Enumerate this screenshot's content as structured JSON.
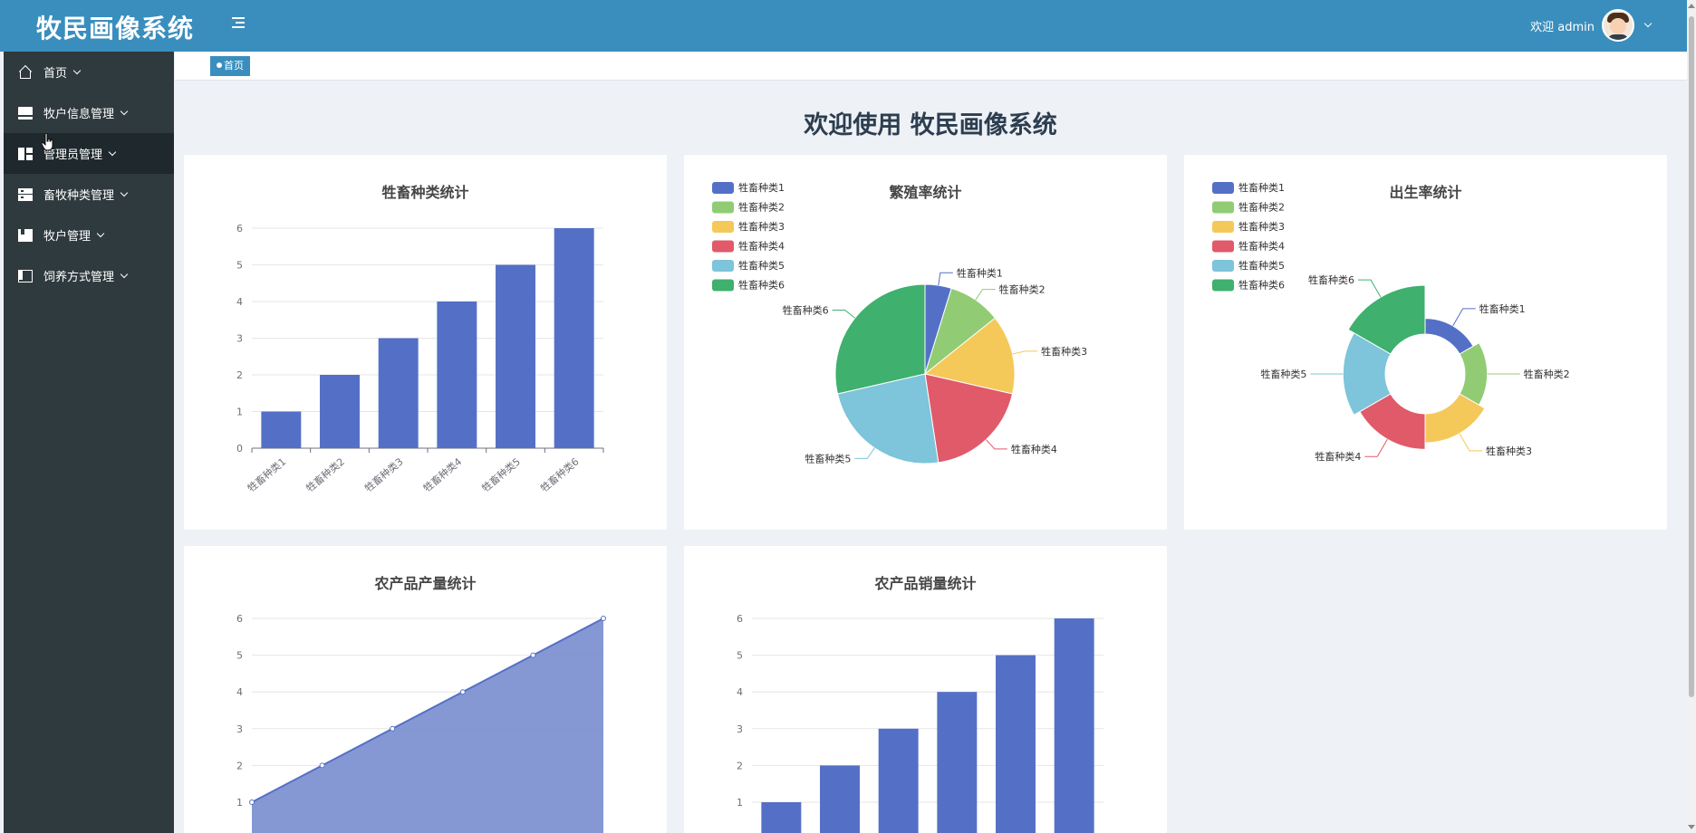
{
  "app": {
    "title": "牧民画像系统"
  },
  "header": {
    "greeting": "欢迎 admin"
  },
  "sidebar": {
    "items": [
      {
        "label": "首页",
        "icon": "home-icon"
      },
      {
        "label": "牧户信息管理",
        "icon": "monitor-icon"
      },
      {
        "label": "管理员管理",
        "icon": "dashboard-icon"
      },
      {
        "label": "畜牧种类管理",
        "icon": "server-icon"
      },
      {
        "label": "牧户管理",
        "icon": "book-icon"
      },
      {
        "label": "饲养方式管理",
        "icon": "panel-icon"
      }
    ]
  },
  "tabs": [
    {
      "label": "首页"
    }
  ],
  "main": {
    "title": "欢迎使用 牧民画像系统"
  },
  "colors": {
    "header": "#3a8ebd",
    "sidebar": "#2f3a3e",
    "palette": [
      "#5470c6",
      "#91cc75",
      "#f5c85a",
      "#e05a69",
      "#7ec4da",
      "#3fb06e"
    ]
  },
  "chart_data": [
    {
      "type": "bar",
      "title": "牲畜种类统计",
      "categories": [
        "牲畜种类1",
        "牲畜种类2",
        "牲畜种类3",
        "牲畜种类4",
        "牲畜种类5",
        "牲畜种类6"
      ],
      "values": [
        1,
        2,
        3,
        4,
        5,
        6
      ],
      "ylim": [
        0,
        6
      ],
      "yticks": [
        "0",
        "1",
        "2",
        "3",
        "4",
        "5",
        "6"
      ]
    },
    {
      "type": "pie",
      "title": "繁殖率统计",
      "legend": [
        "牲畜种类1",
        "牲畜种类2",
        "牲畜种类3",
        "牲畜种类4",
        "牲畜种类5",
        "牲畜种类6"
      ],
      "legend_position": "top-left",
      "values": [
        1,
        2,
        3,
        4,
        5,
        6
      ]
    },
    {
      "type": "pie",
      "title": "出生率统计",
      "legend": [
        "牲畜种类1",
        "牲畜种类2",
        "牲畜种类3",
        "牲畜种类4",
        "牲畜种类5",
        "牲畜种类6"
      ],
      "legend_position": "top-left",
      "values": [
        1,
        2,
        3,
        4,
        5,
        6
      ],
      "rose": true
    },
    {
      "type": "area",
      "title": "农产品产量统计",
      "values": [
        1,
        2,
        3,
        4,
        5,
        6
      ],
      "yticks": [
        "1",
        "2",
        "3",
        "4",
        "5",
        "6"
      ]
    },
    {
      "type": "bar",
      "title": "农产品销量统计",
      "values": [
        1,
        2,
        3,
        4,
        5,
        6
      ],
      "yticks": [
        "1",
        "2",
        "3",
        "4",
        "5",
        "6"
      ]
    }
  ]
}
